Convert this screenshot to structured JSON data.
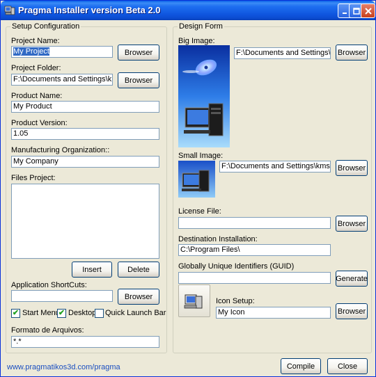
{
  "window": {
    "title": "Pragma Installer version Beta 2.0"
  },
  "setup": {
    "group_label": "Setup Configuration",
    "project_name_label": "Project Name:",
    "project_name_value": "My Project",
    "project_folder_label": "Project Folder:",
    "project_folder_value": "F:\\Documents and Settings\\kms\\D",
    "product_name_label": "Product Name:",
    "product_name_value": "My Product",
    "product_version_label": "Product Version:",
    "product_version_value": "1.05",
    "manufacturer_label": "Manufacturing Organization::",
    "manufacturer_value": "My Company",
    "files_project_label": "Files Project:",
    "insert_label": "Insert",
    "delete_label": "Delete",
    "shortcuts_label": "Application ShortCuts:",
    "shortcuts_value": "",
    "start_menu_label": "Start Menu",
    "start_menu_checked": true,
    "desktop_label": "Desktop",
    "desktop_checked": true,
    "quick_launch_label": "Quick Launch Bar",
    "quick_launch_checked": false,
    "formato_label": "Formato de Arquivos:",
    "formato_value": "*.*",
    "browser_label": "Browser"
  },
  "design": {
    "group_label": "Design Form",
    "big_image_label": "Big Image:",
    "big_image_path": "F:\\Documents and Settings\\kms\\",
    "small_image_label": "Small Image:",
    "small_image_path": "F:\\Documents and Settings\\kms\\Deskt",
    "license_file_label": "License File:",
    "license_file_value": "",
    "destination_label": "Destination Installation:",
    "destination_value": "C:\\Program Files\\",
    "guid_label": "Globally Unique Identifiers (GUID)",
    "guid_value": "",
    "generate_label": "Generate",
    "icon_setup_label": "Icon Setup:",
    "icon_setup_value": "My Icon",
    "browser_label": "Browser"
  },
  "footer": {
    "link": "www.pragmatikos3d.com/pragma",
    "compile_label": "Compile",
    "close_label": "Close"
  },
  "colors": {
    "titlebar": "#0a5fe8",
    "window_bg": "#ece9d8",
    "input_border": "#7f9db9",
    "selection": "#316ac5"
  }
}
